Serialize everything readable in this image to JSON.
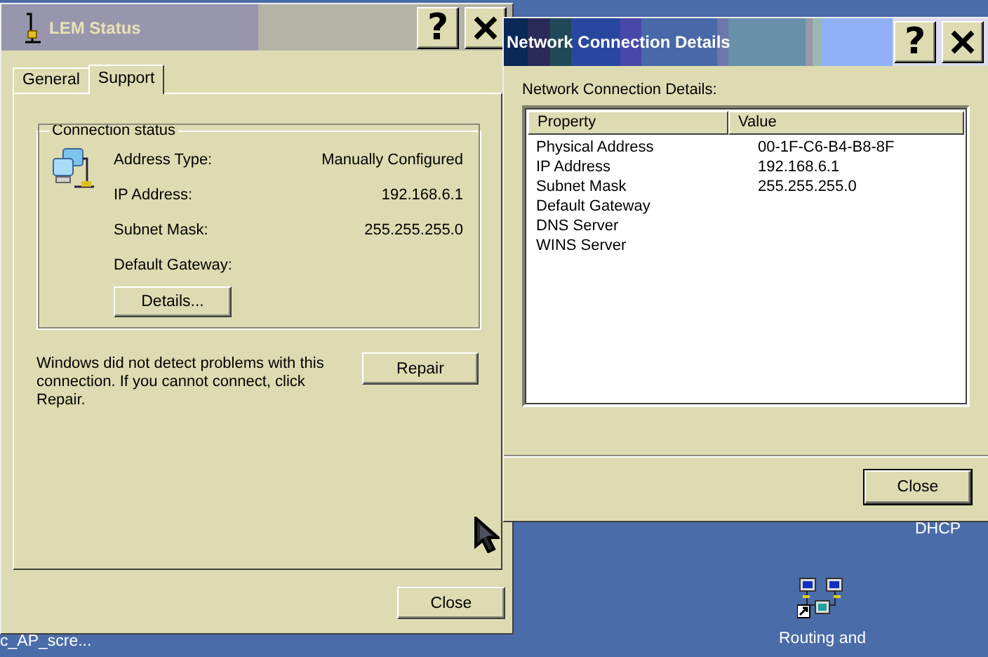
{
  "desktop_icons": [
    {
      "label": "c_AP_scre...",
      "kind": "text"
    },
    {
      "label": "DHCP",
      "kind": "text"
    },
    {
      "label": "Routing and",
      "kind": "network"
    }
  ],
  "status_window": {
    "title": "LEM Status",
    "help_button": "?",
    "tabs": [
      {
        "label": "General",
        "selected": false
      },
      {
        "label": "Support",
        "selected": true
      }
    ],
    "group_title": "Connection status",
    "fields": [
      {
        "label": "Address Type:",
        "value": "Manually Configured"
      },
      {
        "label": "IP Address:",
        "value": "192.168.6.1"
      },
      {
        "label": "Subnet Mask:",
        "value": "255.255.255.0"
      },
      {
        "label": "Default Gateway:"
      }
    ],
    "details_button": "Details...",
    "message": "Windows did not detect problems with this connection. If you cannot connect, click Repair.",
    "repair_button": "Repair",
    "close_button": "Close"
  },
  "details_window": {
    "title": "Network Connection Details",
    "help_button": "?",
    "list_label": "Network Connection Details:",
    "columns": [
      "Property",
      "Value"
    ],
    "rows": [
      {
        "property": "Physical Address",
        "value": "00-1F-C6-B4-B8-8F"
      },
      {
        "property": "IP Address",
        "value": "192.168.6.1"
      },
      {
        "property": "Subnet Mask",
        "value": "255.255.255.0"
      },
      {
        "property": "Default Gateway"
      },
      {
        "property": "DNS Server"
      },
      {
        "property": "WINS Server"
      }
    ],
    "close_button": "Close"
  }
}
